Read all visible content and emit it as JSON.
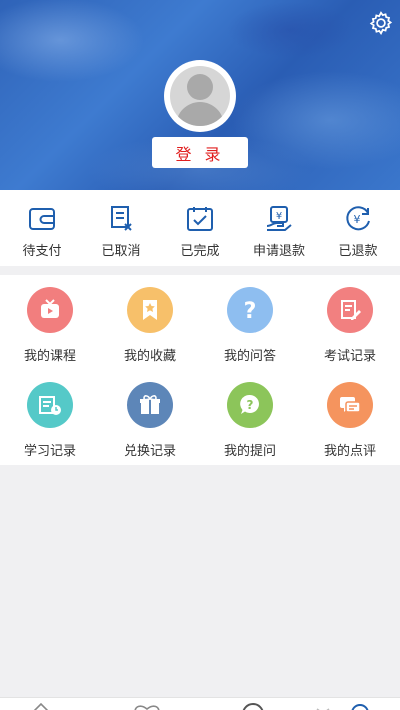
{
  "header": {
    "login_label": "登 录",
    "icons": {
      "settings": "gear-icon",
      "avatar": "avatar-placeholder"
    }
  },
  "orders": [
    {
      "label": "待支付",
      "icon": "wallet-icon"
    },
    {
      "label": "已取消",
      "icon": "cancelled-doc-icon"
    },
    {
      "label": "已完成",
      "icon": "completed-check-icon"
    },
    {
      "label": "申请退款",
      "icon": "refund-request-icon"
    },
    {
      "label": "已退款",
      "icon": "refunded-yen-icon"
    }
  ],
  "menu": [
    {
      "label": "我的课程",
      "icon": "video-play-icon",
      "color": "#f27e7e"
    },
    {
      "label": "我的收藏",
      "icon": "bookmark-star-icon",
      "color": "#f7c06a"
    },
    {
      "label": "我的问答",
      "icon": "question-icon",
      "color": "#8ebef0"
    },
    {
      "label": "考试记录",
      "icon": "exam-edit-icon",
      "color": "#f28080"
    },
    {
      "label": "学习记录",
      "icon": "study-history-icon",
      "color": "#55c9c8"
    },
    {
      "label": "兑换记录",
      "icon": "gift-icon",
      "color": "#5d86b8"
    },
    {
      "label": "我的提问",
      "icon": "question-bubble-icon",
      "color": "#8cc55a"
    },
    {
      "label": "我的点评",
      "icon": "comment-icon",
      "color": "#f5945e"
    }
  ],
  "colors": {
    "accent": "#1f5fae",
    "login_text": "#e02020"
  },
  "tabbar": {
    "icons": [
      "home-icon",
      "heart-icon",
      "explore-icon",
      "star-icon",
      "profile-icon"
    ]
  }
}
